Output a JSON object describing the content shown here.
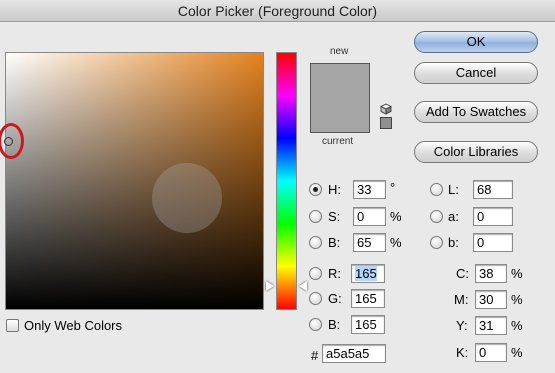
{
  "window": {
    "title": "Color Picker (Foreground Color)"
  },
  "preview": {
    "new_label": "new",
    "current_label": "current",
    "new_color": "#a5a5a5",
    "current_color": "#a5a5a5"
  },
  "buttons": {
    "ok": "OK",
    "cancel": "Cancel",
    "add_to_swatches": "Add To Swatches",
    "color_libraries": "Color Libraries"
  },
  "hsb": {
    "h": {
      "label": "H:",
      "value": "33",
      "unit": "°",
      "selected": true
    },
    "s": {
      "label": "S:",
      "value": "0",
      "unit": "%"
    },
    "b": {
      "label": "B:",
      "value": "65",
      "unit": "%"
    }
  },
  "rgb": {
    "r": {
      "label": "R:",
      "value": "165"
    },
    "g": {
      "label": "G:",
      "value": "165"
    },
    "b": {
      "label": "B:",
      "value": "165"
    }
  },
  "lab": {
    "l": {
      "label": "L:",
      "value": "68"
    },
    "a": {
      "label": "a:",
      "value": "0"
    },
    "b": {
      "label": "b:",
      "value": "0"
    }
  },
  "cmyk": {
    "c": {
      "label": "C:",
      "value": "38",
      "unit": "%"
    },
    "m": {
      "label": "M:",
      "value": "30",
      "unit": "%"
    },
    "y": {
      "label": "Y:",
      "value": "31",
      "unit": "%"
    },
    "k": {
      "label": "K:",
      "value": "0",
      "unit": "%"
    }
  },
  "hex": {
    "label": "#",
    "value": "a5a5a5"
  },
  "web_colors": {
    "label": "Only Web Colors",
    "checked": false
  },
  "colors": {
    "field_hue": "#e3821f",
    "annotation_ring": "#d0161b"
  }
}
